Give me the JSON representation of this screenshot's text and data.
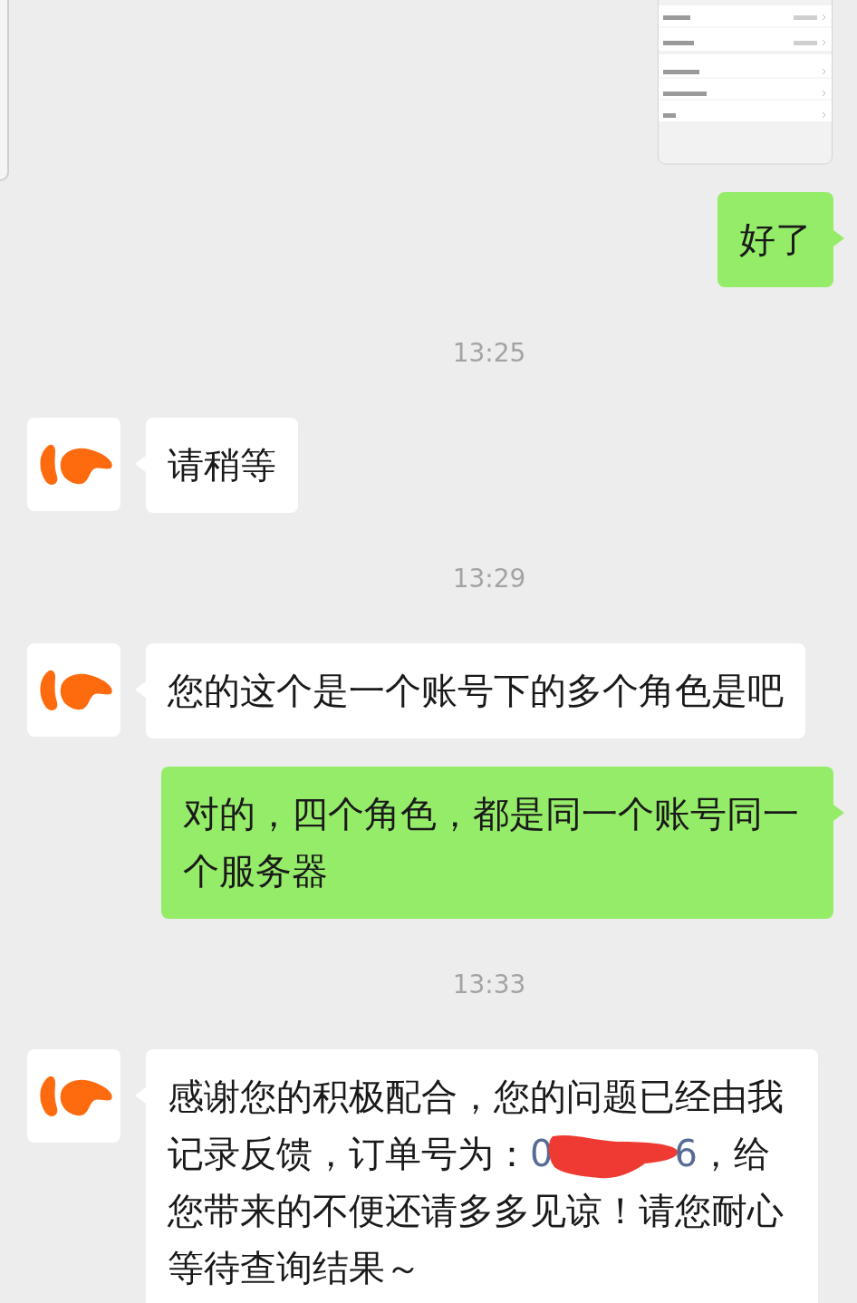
{
  "messages": [
    {
      "kind": "image",
      "outgoing": true
    },
    {
      "kind": "text",
      "outgoing": true,
      "text": "好了"
    },
    {
      "kind": "time",
      "text": "13:25"
    },
    {
      "kind": "text",
      "outgoing": false,
      "text": "请稍等"
    },
    {
      "kind": "time",
      "text": "13:29"
    },
    {
      "kind": "text",
      "outgoing": false,
      "text": "您的这个是一个账号下的多个角色是吧"
    },
    {
      "kind": "text",
      "outgoing": true,
      "text": "对的，四个角色，都是同一个账号同一个服务器"
    },
    {
      "kind": "time",
      "text": "13:33"
    },
    {
      "kind": "rich",
      "outgoing": false,
      "parts": [
        {
          "kind": "text",
          "text": "感谢您的积极配合，您的问题已经由我记录反馈，订单号为："
        },
        {
          "kind": "link",
          "text": "0"
        },
        {
          "kind": "redaction"
        },
        {
          "kind": "link",
          "text": "6"
        },
        {
          "kind": "text",
          "text": "，给您带来的不便还请多多见谅！请您耐心等待查询结果～"
        }
      ]
    }
  ]
}
